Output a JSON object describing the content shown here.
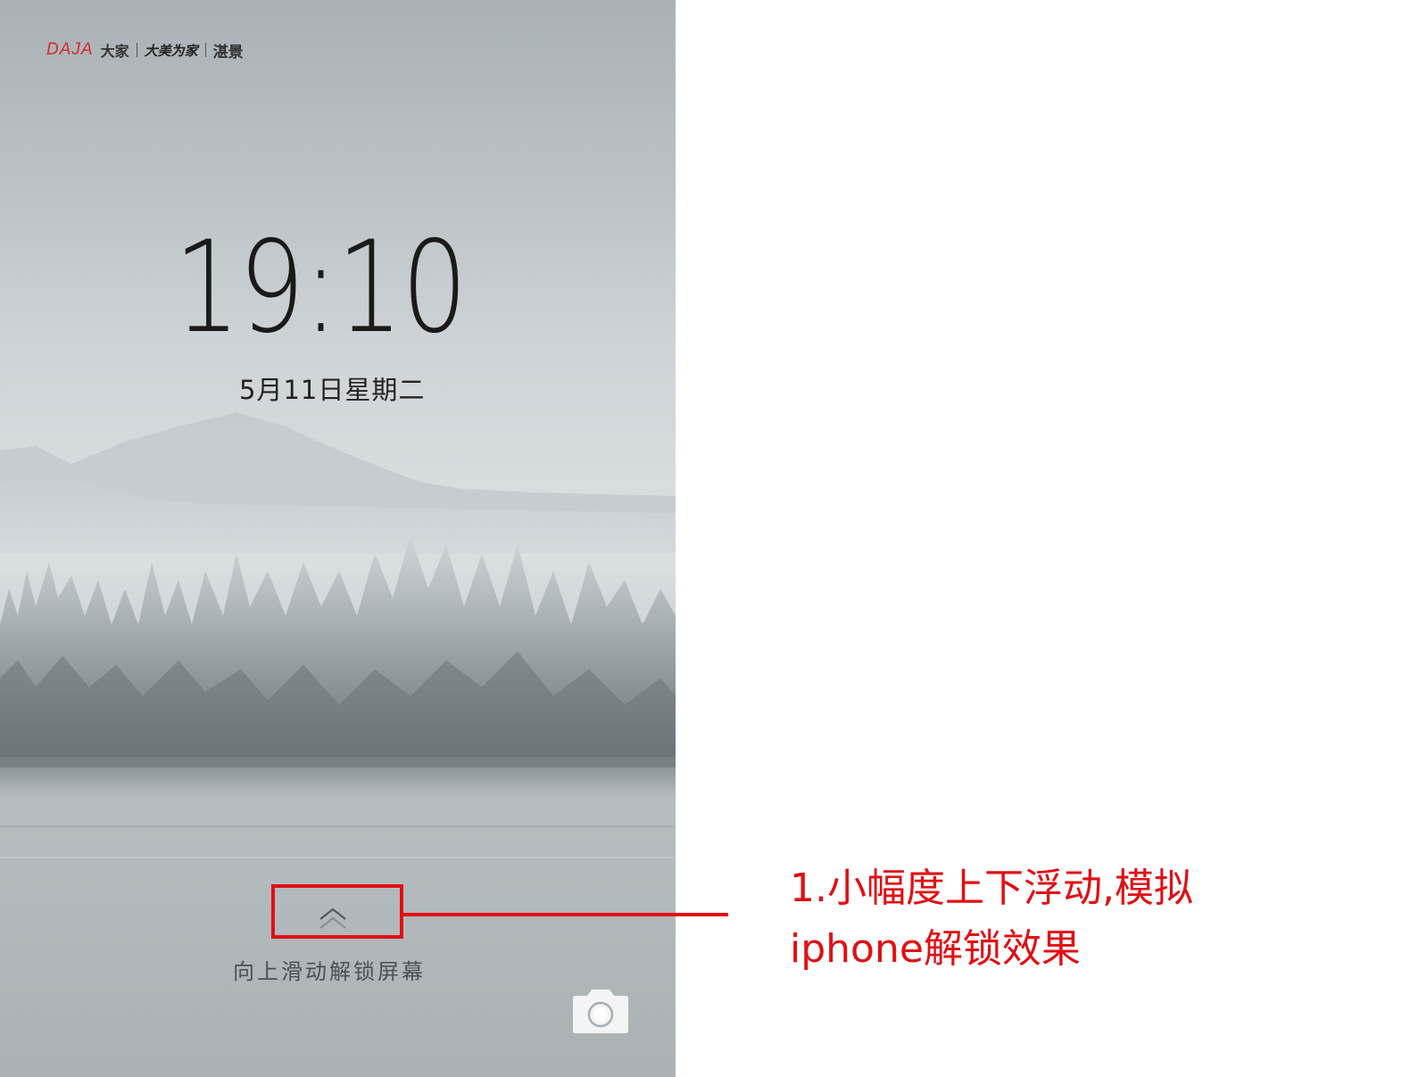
{
  "logo": {
    "brand_latin": "DAJA",
    "brand_cn": "大家",
    "slogan": "大美为家",
    "partner": "湛景"
  },
  "lockscreen": {
    "time": "19:10",
    "date": "5月11日星期二",
    "swipe_hint": "向上滑动解锁屏幕",
    "swipe_icon": "double-chevron-up-icon",
    "camera_icon": "camera-icon"
  },
  "annotation": {
    "line1": "1.小幅度上下浮动,模拟",
    "line2": "iphone解锁效果",
    "color": "#e10f14"
  }
}
